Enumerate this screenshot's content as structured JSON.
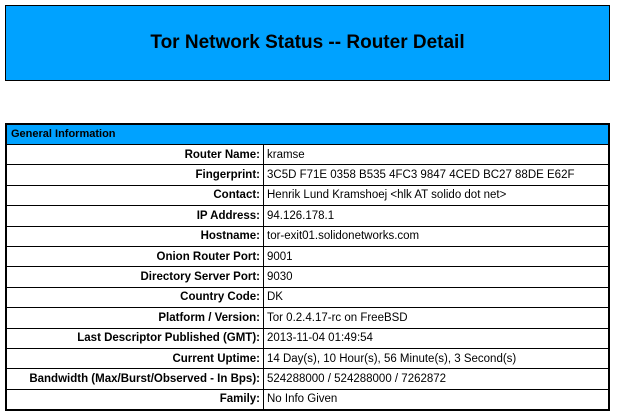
{
  "header": {
    "title": "Tor Network Status -- Router Detail"
  },
  "general": {
    "section_title": "General Information",
    "rows": [
      {
        "label": "Router Name:",
        "value": "kramse"
      },
      {
        "label": "Fingerprint:",
        "value": "3C5D F71E 0358 B535 4FC3 9847 4CED BC27 88DE E62F"
      },
      {
        "label": "Contact:",
        "value": "Henrik Lund Kramshoej <hlk AT solido dot net>"
      },
      {
        "label": "IP Address:",
        "value": "94.126.178.1"
      },
      {
        "label": "Hostname:",
        "value": "tor-exit01.solidonetworks.com"
      },
      {
        "label": "Onion Router Port:",
        "value": "9001"
      },
      {
        "label": "Directory Server Port:",
        "value": "9030"
      },
      {
        "label": "Country Code:",
        "value": "DK"
      },
      {
        "label": "Platform / Version:",
        "value": "Tor 0.2.4.17-rc on FreeBSD"
      },
      {
        "label": "Last Descriptor Published (GMT):",
        "value": "2013-11-04 01:49:54"
      },
      {
        "label": "Current Uptime:",
        "value": "14 Day(s), 10 Hour(s), 56 Minute(s), 3 Second(s)"
      },
      {
        "label": "Bandwidth (Max/Burst/Observed - In Bps):",
        "value": "524288000 / 524288000 / 7262872"
      },
      {
        "label": "Family:",
        "value": "No Info Given"
      }
    ]
  },
  "colors": {
    "accent": "#00a2ff",
    "border": "#000000"
  }
}
